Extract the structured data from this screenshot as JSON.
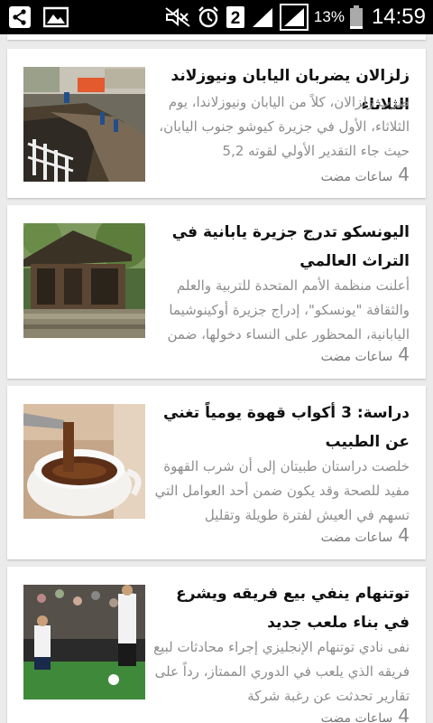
{
  "status_bar": {
    "left_icons": [
      "share-icon",
      "image-icon"
    ],
    "right_icons": [
      "mute-icon",
      "alarm-icon",
      "sim-2-icon",
      "signal-icon",
      "signal-outline-icon",
      "battery-icon"
    ],
    "sim_label": "2",
    "battery_percent": "13%",
    "battery_level": 0.13,
    "time": "14:59"
  },
  "articles": [
    {
      "title": "زلزالان يضربان اليابان ونيوزلاند الثلاثاء",
      "summary": "ضرب زلزالان، كلاً من اليابان ونيوزلاندا، يوم الثلاثاء، الأول في جزيرة كيوشو جنوب اليابان، حيث جاء التقدير الأولي لقوته 5,2",
      "time_number": "4",
      "time_text": "ساعات مضت",
      "thumbnail": "earthquake-road-damage"
    },
    {
      "title": "اليونسكو تدرج جزيرة يابانية في التراث العالمي",
      "summary": "أعلنت منظمة الأمم المتحدة للتربية والعلم والثقافة \"يونسكو\"، إدراج جزيرة أوكينوشيما اليابانية، المحظور على النساء دخولها، ضمن",
      "time_number": "4",
      "time_text": "ساعات مضت",
      "thumbnail": "japanese-shrine"
    },
    {
      "title": "دراسة: 3 أكواب قهوة يومياً تغني عن الطبيب",
      "summary": "خلصت دراستان طبيتان إلى أن شرب القهوة مفيد للصحة وقد يكون ضمن أحد العوامل التي تسهم في العيش لفترة طويلة وتقليل",
      "time_number": "4",
      "time_text": "ساعات مضت",
      "thumbnail": "coffee-cup"
    },
    {
      "title": "توتنهام ينفي بيع فريقه ويشرع في بناء ملعب جديد",
      "summary": "نفى نادي توتنهام الإنجليزي إجراء محادثات لبيع فريقه الذي يلعب في الدوري الممتاز، رداً على تقارير تحدثت عن رغبة شركة",
      "time_number": "4",
      "time_text": "ساعات مضت",
      "thumbnail": "football-match"
    }
  ]
}
